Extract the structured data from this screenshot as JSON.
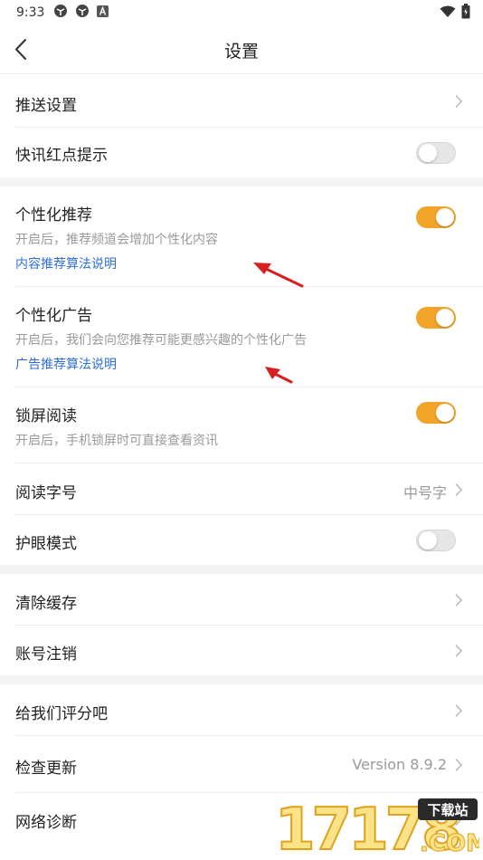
{
  "status_bar": {
    "time": "9:33",
    "icons": [
      "app-icon",
      "app-icon",
      "a-icon"
    ],
    "right_icons": [
      "wifi-icon",
      "battery-icon"
    ]
  },
  "nav": {
    "title": "设置"
  },
  "sections": [
    {
      "rows": [
        {
          "id": "push",
          "title": "推送设置",
          "control": "chevron"
        },
        {
          "id": "news-dot",
          "title": "快讯红点提示",
          "control": "toggle",
          "on": false
        }
      ]
    },
    {
      "rows": [
        {
          "id": "personal-rec",
          "title": "个性化推荐",
          "desc": "开启后，推荐频道会增加个性化内容",
          "link": "内容推荐算法说明",
          "control": "toggle",
          "on": true
        },
        {
          "id": "personal-ads",
          "title": "个性化广告",
          "desc": "开启后，我们会向您推荐可能更感兴趣的个性化广告",
          "link": "广告推荐算法说明",
          "control": "toggle",
          "on": true
        },
        {
          "id": "lock-read",
          "title": "锁屏阅读",
          "desc": "开启后，手机锁屏时可直接查看资讯",
          "control": "toggle",
          "on": true
        },
        {
          "id": "font-size",
          "title": "阅读字号",
          "value": "中号字",
          "control": "chevron"
        },
        {
          "id": "eye-care",
          "title": "护眼模式",
          "control": "toggle",
          "on": false
        }
      ]
    },
    {
      "rows": [
        {
          "id": "clear-cache",
          "title": "清除缓存",
          "control": "chevron"
        },
        {
          "id": "delete-account",
          "title": "账号注销",
          "control": "chevron"
        }
      ]
    },
    {
      "rows": [
        {
          "id": "rate-us",
          "title": "给我们评分吧",
          "control": "chevron"
        },
        {
          "id": "check-update",
          "title": "检查更新",
          "value": "Version 8.9.2",
          "control": "chevron"
        },
        {
          "id": "network-diag",
          "title": "网络诊断",
          "control": "chevron"
        }
      ]
    }
  ],
  "watermark": {
    "number": "17178",
    "tag": "下载站",
    "suffix": ".COM"
  },
  "colors": {
    "toggle_on": "#f2a428",
    "link": "#2f6fd4",
    "annotation_arrow": "#d81e1e"
  }
}
